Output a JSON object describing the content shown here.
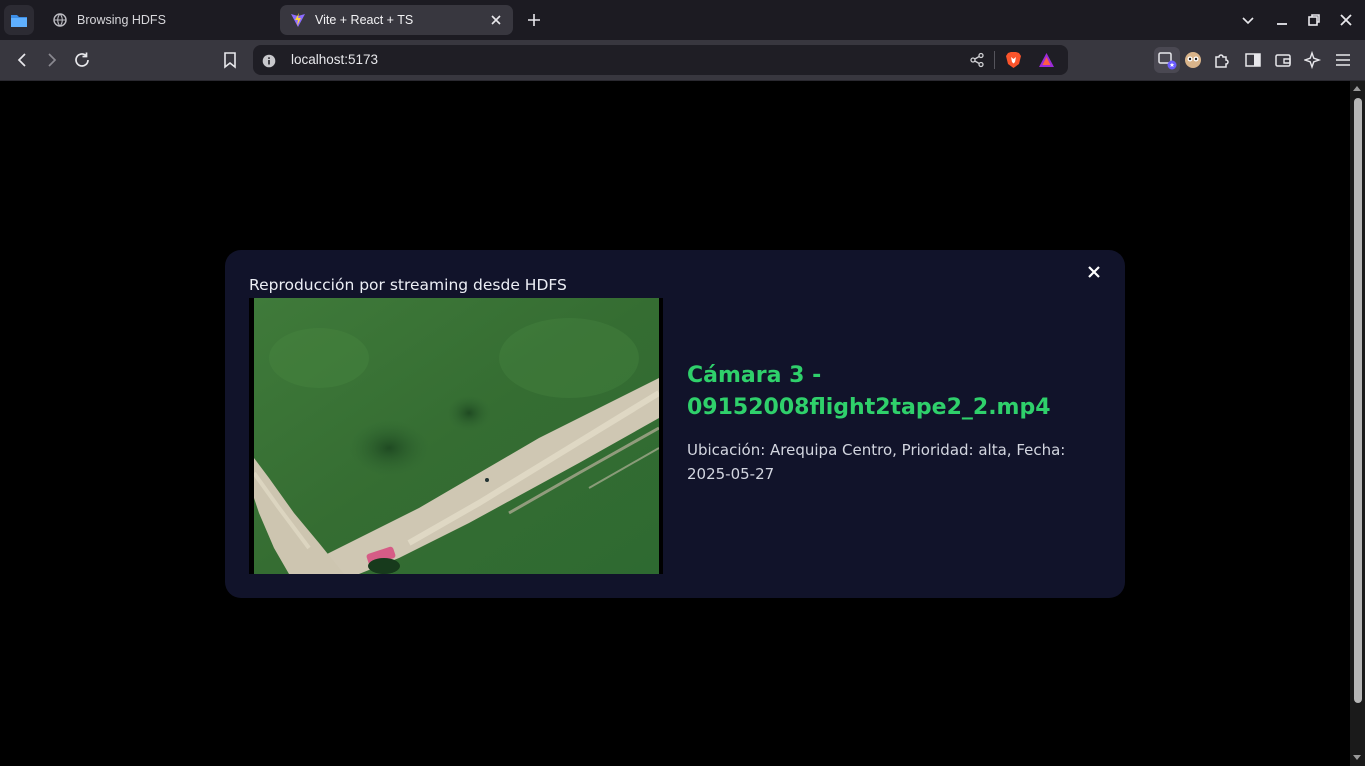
{
  "browser": {
    "tabs": [
      {
        "title": "Browsing HDFS",
        "icon": "globe-icon",
        "active": false
      },
      {
        "title": "Vite + React + TS",
        "icon": "vite-icon",
        "active": true
      }
    ],
    "url": "localhost:5173"
  },
  "modal": {
    "heading": "Reproducción por streaming desde HDFS",
    "camera_title": "Cámara 3 - 09152008flight2tape2_2.mp4",
    "camera_meta": "Ubicación: Arequipa Centro, Prioridad: alta, Fecha: 2025-05-27",
    "title_color": "#2fd06b",
    "background_color": "#11132a"
  }
}
